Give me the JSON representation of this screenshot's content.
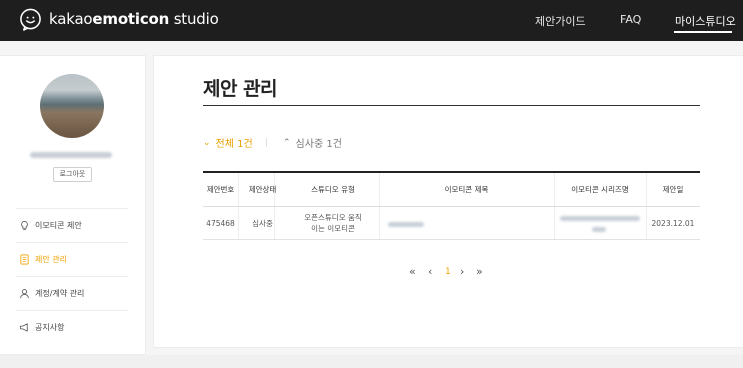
{
  "header": {
    "brand_prefix": "kakao",
    "brand_bold": "emoticon",
    "brand_suffix": " studio",
    "nav": [
      {
        "label": "제안가이드"
      },
      {
        "label": "FAQ"
      },
      {
        "label": "마이스튜디오"
      }
    ],
    "active_nav": "마이스튜디오"
  },
  "sidebar": {
    "logout_label": "로그아웃",
    "items": [
      {
        "label": "이모티콘 제안",
        "icon": "lightbulb-icon"
      },
      {
        "label": "제안 관리",
        "icon": "document-icon",
        "active": true
      },
      {
        "label": "계정/계약 관리",
        "icon": "person-icon"
      },
      {
        "label": "공지사항",
        "icon": "megaphone-icon"
      }
    ]
  },
  "main": {
    "title": "제안 관리",
    "filters": [
      {
        "label": "전체 1건",
        "active": true
      },
      {
        "label": "심사중 1건",
        "active": false
      }
    ],
    "table": {
      "headers": [
        "제안번호",
        "제안상태",
        "스튜디오 유형",
        "이모티콘 제목",
        "이모티콘 시리즈명",
        "제안일"
      ],
      "rows": [
        {
          "id": "475468",
          "status": "심사중",
          "type": "오픈스튜디오 움직이는 이모티콘",
          "date": "2023.12.01"
        }
      ]
    },
    "pagination": {
      "first": "«",
      "prev": "‹",
      "current": "1",
      "next": "›",
      "last": "»"
    }
  },
  "colors": {
    "accent": "#f2a100",
    "topbar": "#1e1e1e"
  }
}
